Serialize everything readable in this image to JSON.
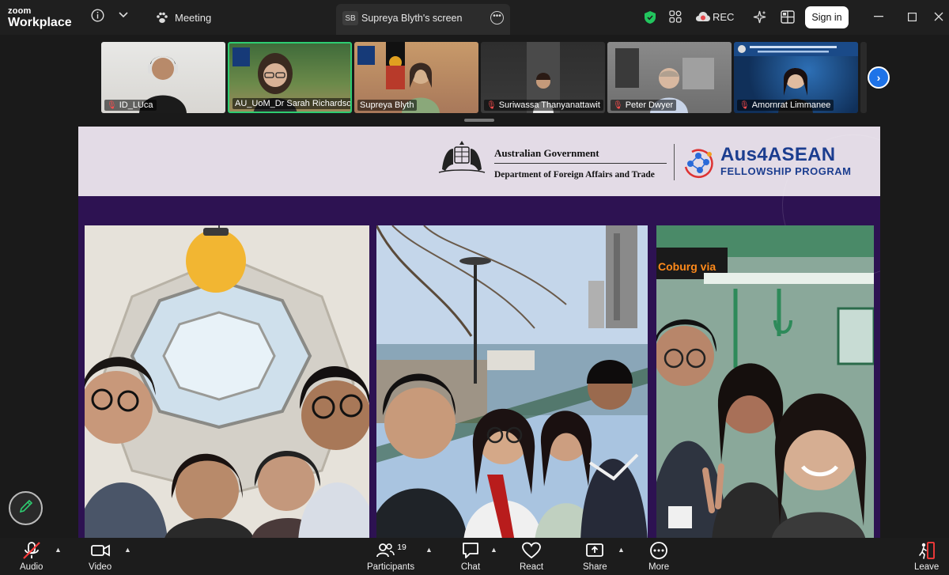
{
  "app": {
    "logo_line1": "zoom",
    "logo_line2": "Workplace"
  },
  "titlebar": {
    "meeting_label": "Meeting",
    "screen_tab": {
      "badge": "SB",
      "title": "Supreya Blyth's screen"
    },
    "rec_label": "REC",
    "signin_label": "Sign in"
  },
  "participants": [
    {
      "name": "ID_LUca",
      "muted": true,
      "active": false
    },
    {
      "name": "AU_UoM_Dr Sarah Richardson",
      "muted": false,
      "active": true
    },
    {
      "name": "Supreya Blyth",
      "muted": false,
      "active": false
    },
    {
      "name": "Suriwassa Thanyanattawit",
      "muted": true,
      "active": false
    },
    {
      "name": "Peter Dwyer",
      "muted": true,
      "active": false
    },
    {
      "name": "Amornrat Limmanee",
      "muted": true,
      "active": false
    }
  ],
  "slide": {
    "gov_line1": "Australian Government",
    "gov_line2": "Department of Foreign Affairs and Trade",
    "program_line1": "Aus4ASEAN",
    "program_line2": "FELLOWSHIP PROGRAM",
    "tram_sign": "Coburg via"
  },
  "toolbar": {
    "audio": "Audio",
    "video": "Video",
    "participants": "Participants",
    "participants_count": "19",
    "chat": "Chat",
    "react": "React",
    "share": "Share",
    "more": "More",
    "leave": "Leave"
  },
  "colors": {
    "accent_blue": "#1e73e8",
    "active_speaker": "#2ecc71",
    "shield_green": "#22c55e",
    "rec_red": "#e5484d",
    "slide_purple": "#2d1252",
    "program_blue": "#1b3d8f"
  }
}
